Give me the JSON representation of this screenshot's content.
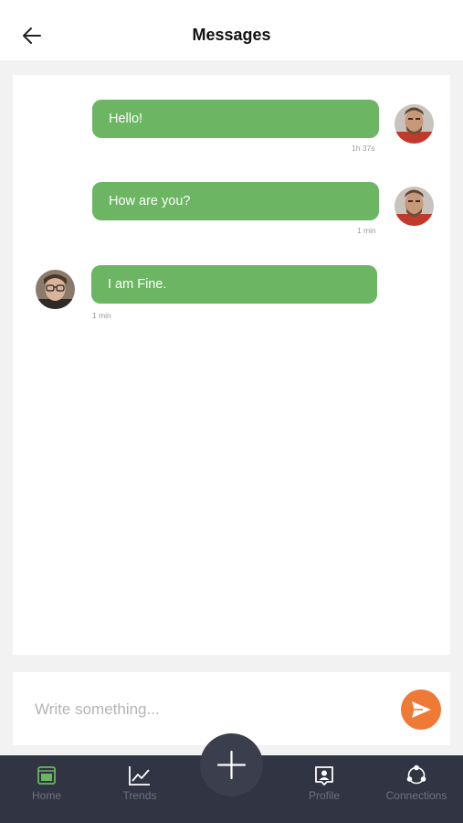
{
  "header": {
    "title": "Messages",
    "back_icon": "arrow-left-icon"
  },
  "messages": [
    {
      "text": "Hello!",
      "time": "1h 37s",
      "side": "right"
    },
    {
      "text": "How are you?",
      "time": "1 min",
      "side": "right"
    },
    {
      "text": "I am Fine.",
      "time": "1 min",
      "side": "left"
    }
  ],
  "composer": {
    "placeholder": "Write something...",
    "send_icon": "send-icon"
  },
  "tabs": [
    {
      "label": "Home",
      "icon": "home-icon",
      "active": true
    },
    {
      "label": "Trends",
      "icon": "trends-icon",
      "active": false
    },
    {
      "label": "Profile",
      "icon": "profile-icon",
      "active": false
    },
    {
      "label": "Connections",
      "icon": "connections-icon",
      "active": false
    }
  ],
  "fab": {
    "icon": "plus-icon"
  },
  "colors": {
    "bubble": "#6bb563",
    "accent": "#ef7a35",
    "tabbar": "#303443",
    "tab_active": "#6bb563",
    "tab_inactive": "#6f7380"
  }
}
